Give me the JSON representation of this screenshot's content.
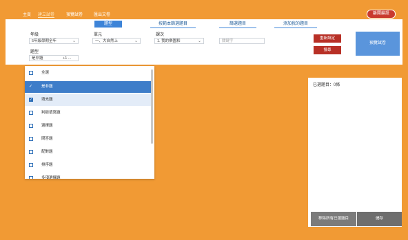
{
  "nav": {
    "crumbs": [
      "主頁",
      "建立試卷",
      "預覽試卷",
      "匯出文卷"
    ],
    "exit_label": "離開編設"
  },
  "tabs": {
    "t1": "題型",
    "t2": "按範本篩選題目",
    "t3": "篩選題目",
    "t4": "添加我的題目"
  },
  "filters": {
    "grade_label": "年級",
    "grade_value": "5年級學期全年",
    "unit_label": "單元",
    "unit_value": "一、大自然上",
    "lesson_label": "課次",
    "lesson_value": "1. 我的樂園和",
    "type_label": "題型",
    "type_value": "是非題",
    "type_extra": "+1 ...",
    "keyword_placeholder": "關鍵字"
  },
  "buttons": {
    "reset": "重新設定",
    "search": "搜尋",
    "preview": "預覽試卷"
  },
  "dropdown": {
    "items": [
      {
        "label": "全選",
        "state": "unchecked"
      },
      {
        "label": "是非題",
        "state": "selected"
      },
      {
        "label": "填充題",
        "state": "checked"
      },
      {
        "label": "判斷填寫題",
        "state": "unchecked"
      },
      {
        "label": "選擇題",
        "state": "unchecked"
      },
      {
        "label": "問答題",
        "state": "unchecked"
      },
      {
        "label": "配對題",
        "state": "unchecked"
      },
      {
        "label": "排序題",
        "state": "unchecked"
      },
      {
        "label": "多項選擇題",
        "state": "unchecked"
      }
    ]
  },
  "side": {
    "title": "已選題目：0條",
    "left_button": "移除所有已選題目",
    "right_button": "儲存"
  },
  "colors": {
    "background": "#f19a34",
    "accent_blue": "#3e7dc9",
    "danger_red": "#b83026"
  }
}
